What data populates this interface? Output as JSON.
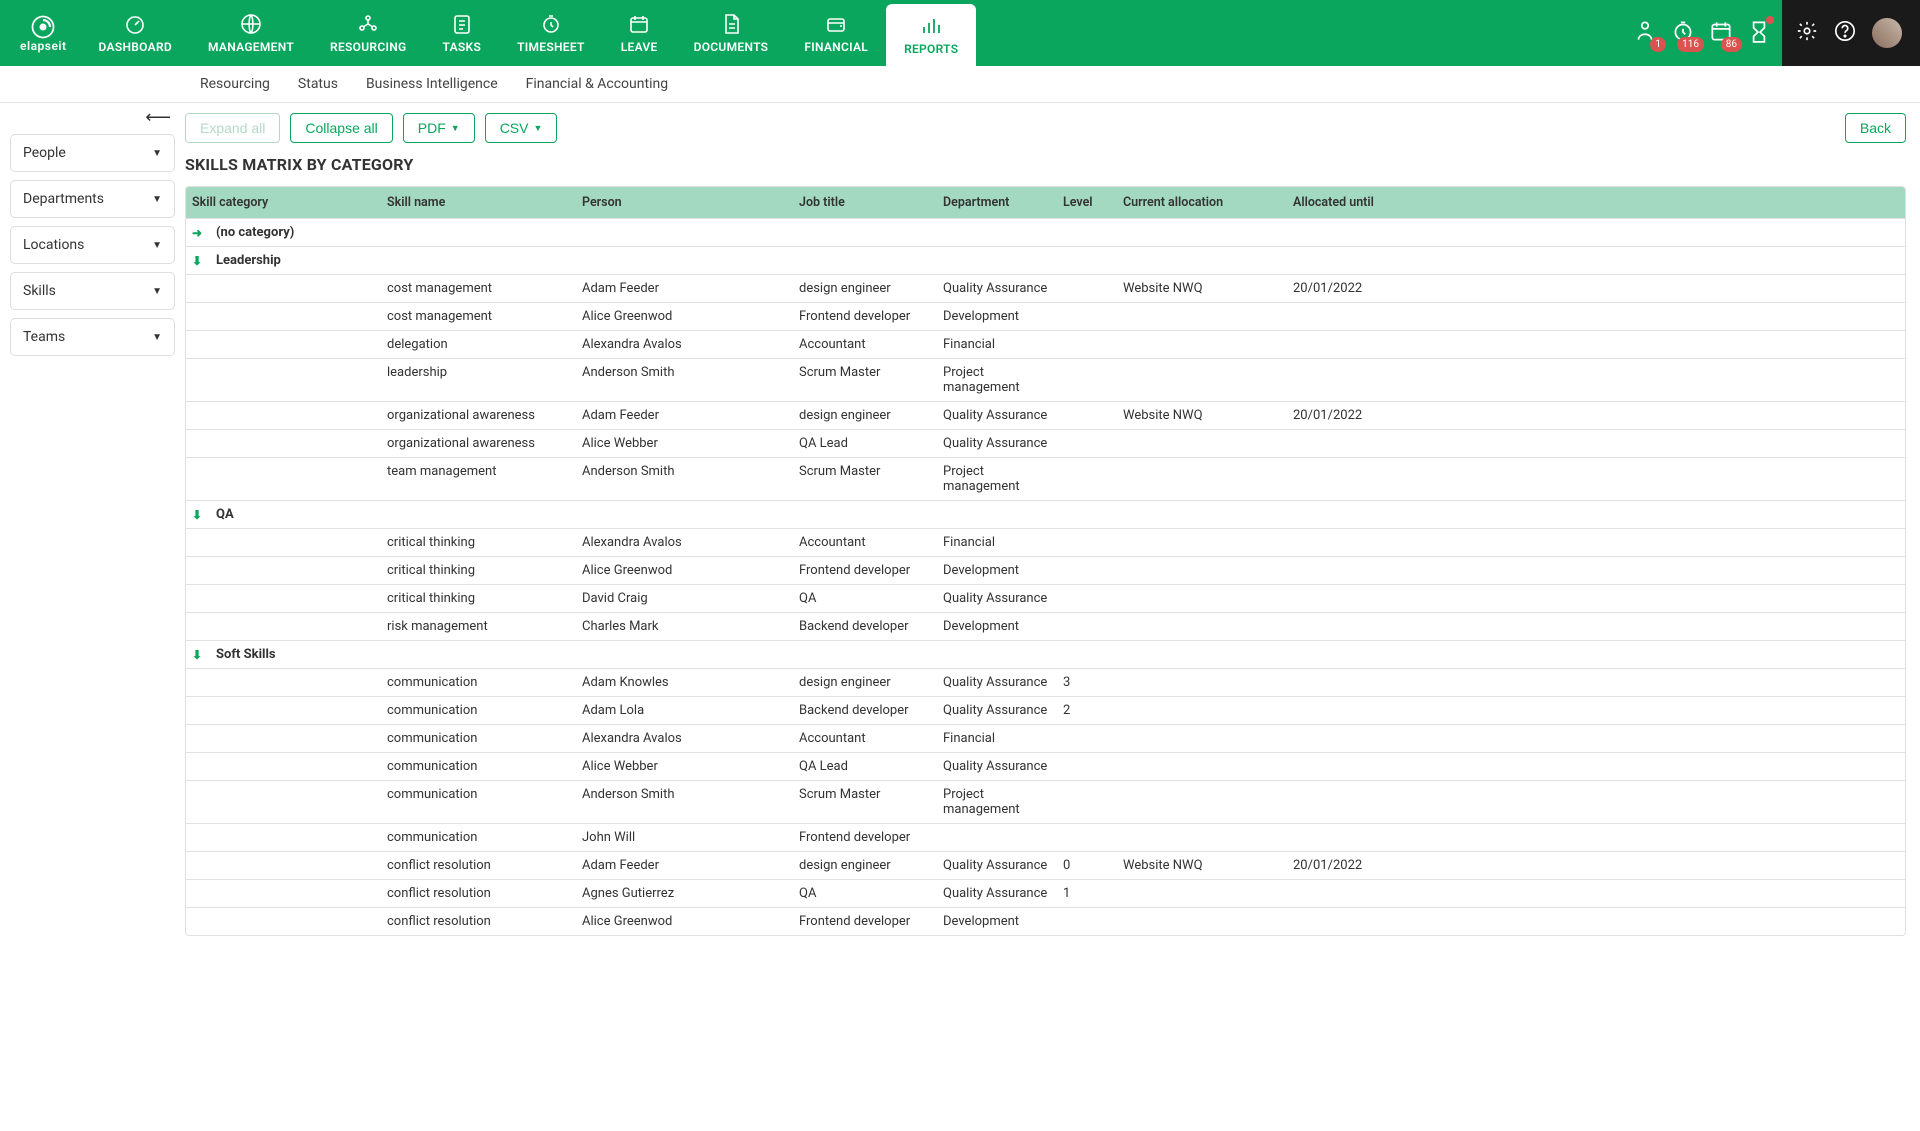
{
  "brand": "elapseit",
  "nav": [
    {
      "id": "dashboard",
      "label": "DASHBOARD"
    },
    {
      "id": "management",
      "label": "MANAGEMENT"
    },
    {
      "id": "resourcing",
      "label": "RESOURCING"
    },
    {
      "id": "tasks",
      "label": "TASKS"
    },
    {
      "id": "timesheet",
      "label": "TIMESHEET"
    },
    {
      "id": "leave",
      "label": "LEAVE"
    },
    {
      "id": "documents",
      "label": "DOCUMENTS"
    },
    {
      "id": "financial",
      "label": "FINANCIAL"
    },
    {
      "id": "reports",
      "label": "REPORTS"
    }
  ],
  "nav_active": "reports",
  "alerts": [
    {
      "id": "a1",
      "count": "1"
    },
    {
      "id": "a2",
      "count": "116"
    },
    {
      "id": "a3",
      "count": "86"
    },
    {
      "id": "a4"
    }
  ],
  "subtabs": [
    "Resourcing",
    "Status",
    "Business Intelligence",
    "Financial & Accounting"
  ],
  "filters": [
    "People",
    "Departments",
    "Locations",
    "Skills",
    "Teams"
  ],
  "toolbar": {
    "expand": "Expand all",
    "collapse": "Collapse all",
    "pdf": "PDF",
    "csv": "CSV",
    "back": "Back"
  },
  "heading": "SKILLS MATRIX BY CATEGORY",
  "columns": [
    "Skill category",
    "Skill name",
    "Person",
    "Job title",
    "Department",
    "Level",
    "Current allocation",
    "Allocated until"
  ],
  "groups": [
    {
      "name": "(no category)",
      "expanded": false,
      "rows": []
    },
    {
      "name": "Leadership",
      "expanded": true,
      "rows": [
        {
          "skill": "cost management",
          "person": "Adam Feeder",
          "job": "design engineer",
          "dept": "Quality Assurance",
          "level": "",
          "alloc": "Website NWQ",
          "until": "20/01/2022"
        },
        {
          "skill": "cost management",
          "person": "Alice Greenwod",
          "job": "Frontend developer",
          "dept": "Development",
          "level": "",
          "alloc": "",
          "until": ""
        },
        {
          "skill": "delegation",
          "person": "Alexandra Avalos",
          "job": "Accountant",
          "dept": "Financial",
          "level": "",
          "alloc": "",
          "until": ""
        },
        {
          "skill": "leadership",
          "person": "Anderson Smith",
          "job": "Scrum Master",
          "dept": "Project management",
          "level": "",
          "alloc": "",
          "until": ""
        },
        {
          "skill": "organizational awareness",
          "person": "Adam Feeder",
          "job": "design engineer",
          "dept": "Quality Assurance",
          "level": "",
          "alloc": "Website NWQ",
          "until": "20/01/2022"
        },
        {
          "skill": "organizational awareness",
          "person": "Alice Webber",
          "job": "QA Lead",
          "dept": "Quality Assurance",
          "level": "",
          "alloc": "",
          "until": ""
        },
        {
          "skill": "team management",
          "person": "Anderson Smith",
          "job": "Scrum Master",
          "dept": "Project management",
          "level": "",
          "alloc": "",
          "until": ""
        }
      ]
    },
    {
      "name": "QA",
      "expanded": true,
      "rows": [
        {
          "skill": "critical thinking",
          "person": "Alexandra Avalos",
          "job": "Accountant",
          "dept": "Financial",
          "level": "",
          "alloc": "",
          "until": ""
        },
        {
          "skill": "critical thinking",
          "person": "Alice Greenwod",
          "job": "Frontend developer",
          "dept": "Development",
          "level": "",
          "alloc": "",
          "until": ""
        },
        {
          "skill": "critical thinking",
          "person": "David Craig",
          "job": "QA",
          "dept": "Quality Assurance",
          "level": "",
          "alloc": "",
          "until": ""
        },
        {
          "skill": "risk management",
          "person": "Charles Mark",
          "job": "Backend developer",
          "dept": "Development",
          "level": "",
          "alloc": "",
          "until": ""
        }
      ]
    },
    {
      "name": "Soft Skills",
      "expanded": true,
      "rows": [
        {
          "skill": "communication",
          "person": "Adam Knowles",
          "job": "design engineer",
          "dept": "Quality Assurance",
          "level": "3",
          "alloc": "",
          "until": ""
        },
        {
          "skill": "communication",
          "person": "Adam Lola",
          "job": "Backend developer",
          "dept": "Quality Assurance",
          "level": "2",
          "alloc": "",
          "until": ""
        },
        {
          "skill": "communication",
          "person": "Alexandra Avalos",
          "job": "Accountant",
          "dept": "Financial",
          "level": "",
          "alloc": "",
          "until": ""
        },
        {
          "skill": "communication",
          "person": "Alice Webber",
          "job": "QA Lead",
          "dept": "Quality Assurance",
          "level": "",
          "alloc": "",
          "until": ""
        },
        {
          "skill": "communication",
          "person": "Anderson Smith",
          "job": "Scrum Master",
          "dept": "Project management",
          "level": "",
          "alloc": "",
          "until": ""
        },
        {
          "skill": "communication",
          "person": "John Will",
          "job": "Frontend developer",
          "dept": "",
          "level": "",
          "alloc": "",
          "until": ""
        },
        {
          "skill": "conflict resolution",
          "person": "Adam Feeder",
          "job": "design engineer",
          "dept": "Quality Assurance",
          "level": "0",
          "alloc": "Website NWQ",
          "until": "20/01/2022"
        },
        {
          "skill": "conflict resolution",
          "person": "Agnes Gutierrez",
          "job": "QA",
          "dept": "Quality Assurance",
          "level": "1",
          "alloc": "",
          "until": ""
        },
        {
          "skill": "conflict resolution",
          "person": "Alice Greenwod",
          "job": "Frontend developer",
          "dept": "Development",
          "level": "",
          "alloc": "",
          "until": ""
        }
      ]
    }
  ]
}
